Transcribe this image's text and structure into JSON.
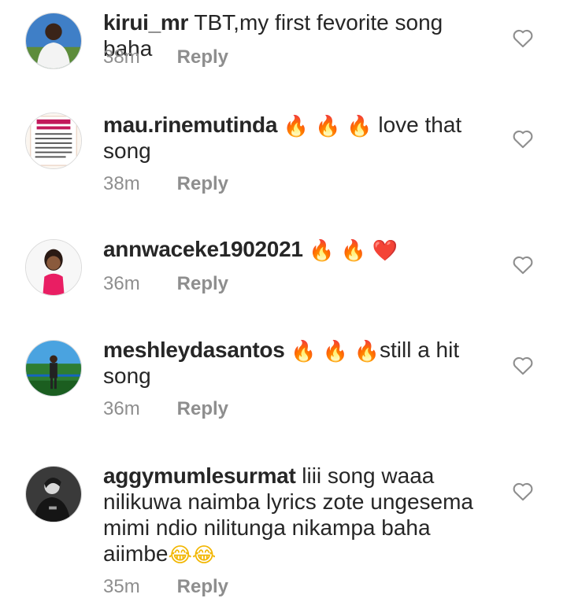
{
  "reply_label": "Reply",
  "icons": {
    "fire": "🔥",
    "heart": "❤️",
    "laugh": "😂",
    "like": "heart-outline-icon"
  },
  "colors": {
    "text": "#262626",
    "meta": "#8e8e8e",
    "fire": "#f4511e",
    "heart": "#d32f2f"
  },
  "comments": [
    {
      "username": "kirui_mr",
      "text": "TBT,my first fevorite song baha",
      "time": "38m"
    },
    {
      "username": "mau.rinemutinda",
      "text_after": "love that song",
      "time": "38m"
    },
    {
      "username": "annwaceke1902021",
      "time": "36m"
    },
    {
      "username": "meshleydasantos",
      "text_after": "still a hit song",
      "time": "36m"
    },
    {
      "username": "aggymumlesurmat",
      "text": "liii song waaa nilikuwa naimba lyrics zote ungesema mimi ndio nilitunga nikampa baha aiimbe",
      "time": "35m"
    }
  ]
}
